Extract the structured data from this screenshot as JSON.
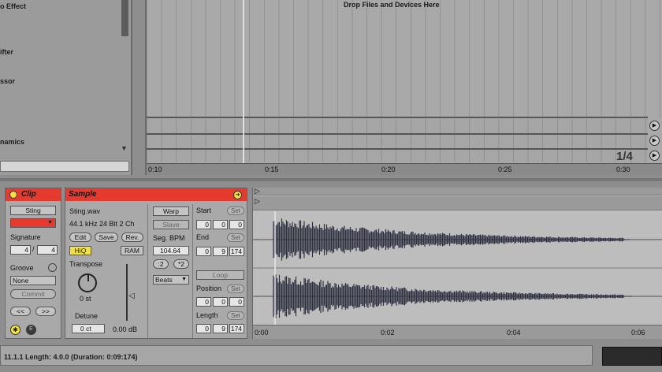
{
  "browser": {
    "items": [
      "o Effect",
      "ifter",
      "ssor",
      "namics"
    ]
  },
  "arrangement": {
    "drop_message": "Drop Files and Devices Here",
    "page_indicator": "1/4",
    "ruler": [
      "0:10",
      "0:15",
      "0:20",
      "0:25",
      "0:30"
    ]
  },
  "clip": {
    "header": "Clip",
    "name": "Sting",
    "signature_label": "Signature",
    "sig_num": "4",
    "sig_den": "4",
    "groove_label": "Groove",
    "groove_value": "None",
    "commit_label": "Commit",
    "prev_label": "<<",
    "next_label": ">>"
  },
  "sample": {
    "header": "Sample",
    "filename": "Sting.wav",
    "format": "44.1 kHz 24 Bit 2 Ch",
    "edit_label": "Edit",
    "save_label": "Save",
    "rev_label": "Rev.",
    "hiq_label": "HiQ",
    "ram_label": "RAM",
    "transpose_label": "Transpose",
    "transpose_value": "0 st",
    "detune_label": "Detune",
    "detune_value": "0 ct",
    "gain_value": "0.00 dB",
    "warp_label": "Warp",
    "slave_label": "Slave",
    "segbpm_label": "Seg. BPM",
    "segbpm_value": "104.64",
    "half_label": ":2",
    "double_label": "*2",
    "mode_value": "Beats",
    "start_label": "Start",
    "start": [
      "0",
      "0",
      "0"
    ],
    "end_label": "End",
    "end": [
      "0",
      "9",
      "174"
    ],
    "loop_label": "Loop",
    "position_label": "Position",
    "position": [
      "0",
      "0",
      "0"
    ],
    "length_label": "Length",
    "length": [
      "0",
      "9",
      "174"
    ],
    "set_label": "Set"
  },
  "wave": {
    "ruler": [
      "0:00",
      "0:02",
      "0:04",
      "0:06"
    ]
  },
  "status": {
    "text": "11.1.1   Length: 4.0.0  (Duration: 0:09:174)"
  },
  "colors": {
    "accent_red": "#e63a2e",
    "hiq_yellow": "#f2e13a"
  }
}
